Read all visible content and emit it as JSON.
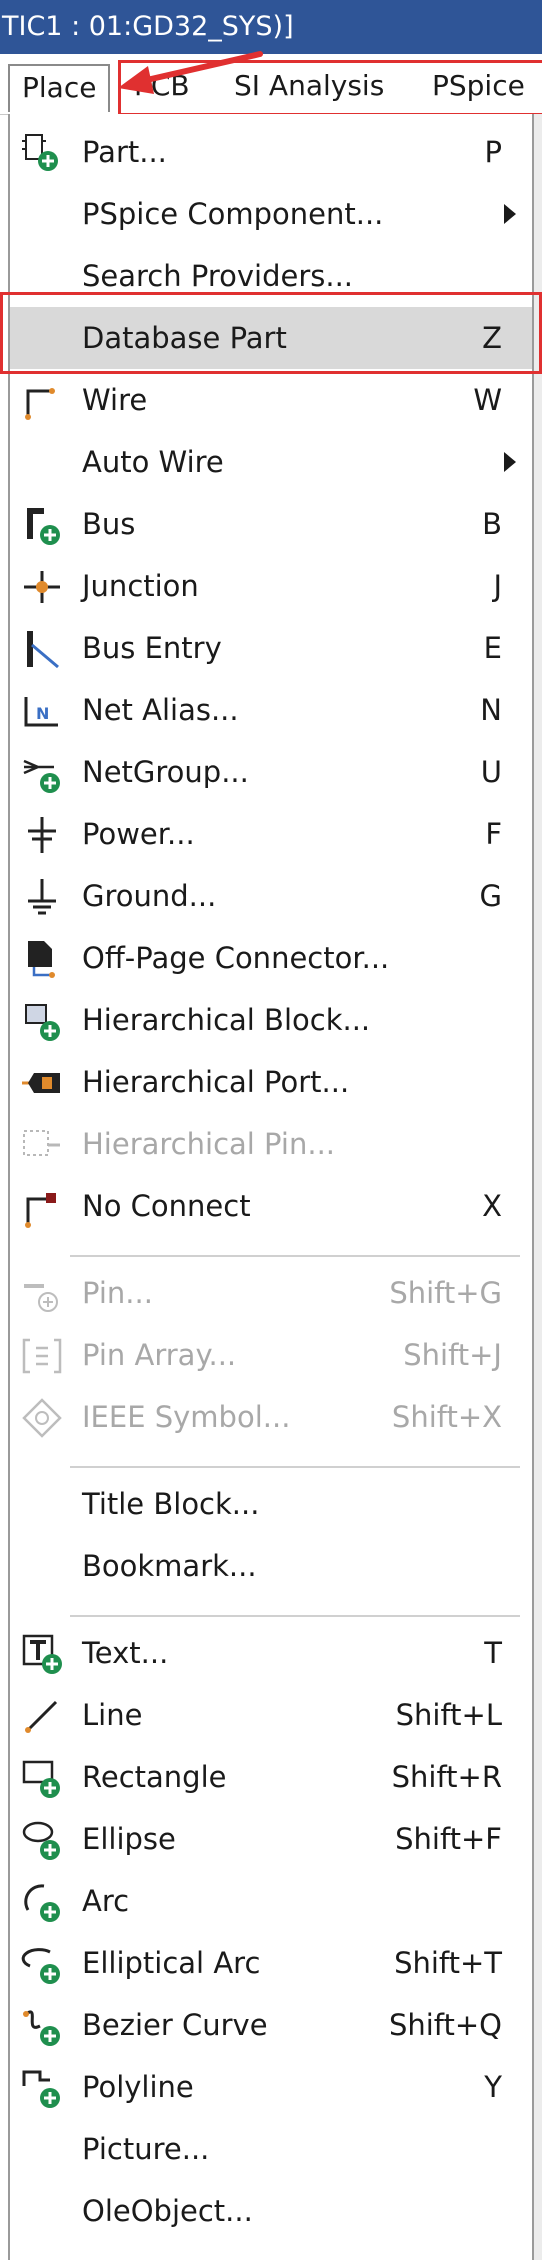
{
  "window": {
    "title": "TIC1 : 01:GD32_SYS)]"
  },
  "menubar": {
    "items": [
      "Place",
      "PCB",
      "SI Analysis",
      "PSpice"
    ]
  },
  "colors": {
    "titlebar": "#2f5597",
    "annotation": "#e03030",
    "icon_green": "#1f8f4e",
    "icon_orange": "#e08a2c"
  },
  "menu": {
    "items": [
      {
        "label": "Part...",
        "shortcut": "P",
        "icon": "part-icon"
      },
      {
        "label": "PSpice Component...",
        "shortcut": "",
        "submenu": true
      },
      {
        "label": "Search Providers...",
        "shortcut": ""
      },
      {
        "label": "Database Part",
        "shortcut": "Z",
        "highlighted": true
      },
      {
        "label": "Wire",
        "shortcut": "W",
        "icon": "wire-icon"
      },
      {
        "label": "Auto Wire",
        "shortcut": "",
        "submenu": true
      },
      {
        "label": "Bus",
        "shortcut": "B",
        "icon": "bus-icon"
      },
      {
        "label": "Junction",
        "shortcut": "J",
        "icon": "junction-icon"
      },
      {
        "label": "Bus Entry",
        "shortcut": "E",
        "icon": "bus-entry-icon"
      },
      {
        "label": "Net Alias...",
        "shortcut": "N",
        "icon": "net-alias-icon"
      },
      {
        "label": "NetGroup...",
        "shortcut": "U",
        "icon": "netgroup-icon"
      },
      {
        "label": "Power...",
        "shortcut": "F",
        "icon": "power-icon"
      },
      {
        "label": "Ground...",
        "shortcut": "G",
        "icon": "ground-icon"
      },
      {
        "label": "Off-Page Connector...",
        "shortcut": "",
        "icon": "off-page-connector-icon"
      },
      {
        "label": "Hierarchical Block...",
        "shortcut": "",
        "icon": "hierarchical-block-icon"
      },
      {
        "label": "Hierarchical Port...",
        "shortcut": "",
        "icon": "hierarchical-port-icon"
      },
      {
        "label": "Hierarchical Pin...",
        "shortcut": "",
        "icon": "hierarchical-pin-icon",
        "disabled": true
      },
      {
        "label": "No Connect",
        "shortcut": "X",
        "icon": "no-connect-icon"
      },
      {
        "label": "Pin...",
        "shortcut": "Shift+G",
        "icon": "pin-icon",
        "disabled": true
      },
      {
        "label": "Pin Array...",
        "shortcut": "Shift+J",
        "icon": "pin-array-icon",
        "disabled": true
      },
      {
        "label": "IEEE Symbol...",
        "shortcut": "Shift+X",
        "icon": "ieee-symbol-icon",
        "disabled": true
      },
      {
        "label": "Title Block...",
        "shortcut": ""
      },
      {
        "label": "Bookmark...",
        "shortcut": ""
      },
      {
        "label": "Text...",
        "shortcut": "T",
        "icon": "text-icon"
      },
      {
        "label": "Line",
        "shortcut": "Shift+L",
        "icon": "line-icon"
      },
      {
        "label": "Rectangle",
        "shortcut": "Shift+R",
        "icon": "rectangle-icon"
      },
      {
        "label": "Ellipse",
        "shortcut": "Shift+F",
        "icon": "ellipse-icon"
      },
      {
        "label": "Arc",
        "shortcut": "",
        "icon": "arc-icon"
      },
      {
        "label": "Elliptical Arc",
        "shortcut": "Shift+T",
        "icon": "elliptical-arc-icon"
      },
      {
        "label": "Bezier Curve",
        "shortcut": "Shift+Q",
        "icon": "bezier-curve-icon"
      },
      {
        "label": "Polyline",
        "shortcut": "Y",
        "icon": "polyline-icon"
      },
      {
        "label": "Picture...",
        "shortcut": ""
      },
      {
        "label": "OleObject...",
        "shortcut": ""
      }
    ]
  }
}
